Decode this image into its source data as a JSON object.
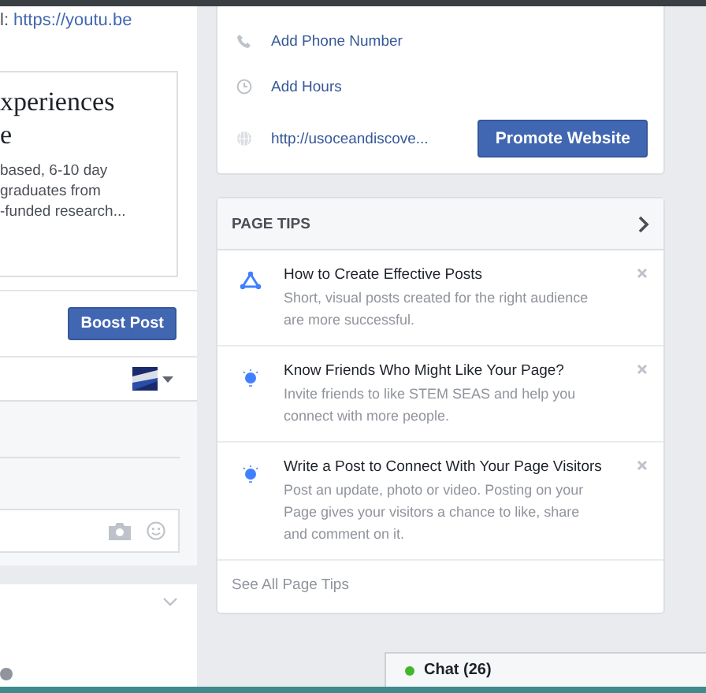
{
  "link_line": {
    "prefix": "l:",
    "url": "https://youtu.be"
  },
  "link_preview": {
    "title_lines": [
      "xperiences",
      "e"
    ],
    "description_lines": [
      "based, 6-10 day",
      "graduates from",
      "-funded research..."
    ]
  },
  "boost_button": "Boost Post",
  "about": {
    "items": [
      {
        "kind": "phone",
        "label": "Add Phone Number"
      },
      {
        "kind": "hours",
        "label": "Add Hours"
      },
      {
        "kind": "website",
        "label": "http://usoceandiscove...",
        "button": "Promote Website"
      }
    ]
  },
  "page_tips": {
    "title": "PAGE TIPS",
    "tips": [
      {
        "kind": "triangle",
        "title": "How to Create Effective Posts",
        "body": "Short, visual posts created for the right audience are more successful."
      },
      {
        "kind": "bulb",
        "title": "Know Friends Who Might Like Your Page?",
        "body": "Invite friends to like STEM SEAS and help you connect with more people."
      },
      {
        "kind": "bulb",
        "title": "Write a Post to Connect With Your Page Visitors",
        "body": "Post an update, photo or video. Posting on your Page gives your visitors a chance to like, share and comment on it."
      }
    ],
    "footer_link": "See All Page Tips"
  },
  "chat": {
    "label": "Chat (26)",
    "online": true
  }
}
